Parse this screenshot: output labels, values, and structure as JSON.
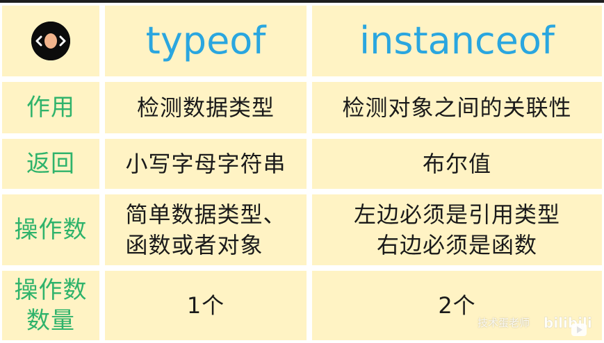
{
  "header": {
    "logo_icon": "code-bracket-face-icon",
    "col1": "typeof",
    "col2": "instanceof"
  },
  "rows": [
    {
      "label": "作用",
      "typeof": "检测数据类型",
      "instanceof": "检测对象之间的关联性"
    },
    {
      "label": "返回",
      "typeof": "小写字母字符串",
      "instanceof": "布尔值"
    },
    {
      "label": "操作数",
      "typeof_lines": [
        "简单数据类型、",
        "函数或者对象"
      ],
      "instanceof_lines": [
        "左边必须是引用类型",
        "右边必须是函数"
      ]
    },
    {
      "label_lines": [
        "操作数",
        "数量"
      ],
      "typeof": "1个",
      "instanceof": "2个"
    }
  ],
  "watermark": {
    "author": "技术蛋老师",
    "brand": "bilibili"
  },
  "colors": {
    "cell_bg": "#fff3c4",
    "label_green": "#2fb36b",
    "header_blue": "#2aa6df",
    "text_dark": "#1a1a1a"
  }
}
